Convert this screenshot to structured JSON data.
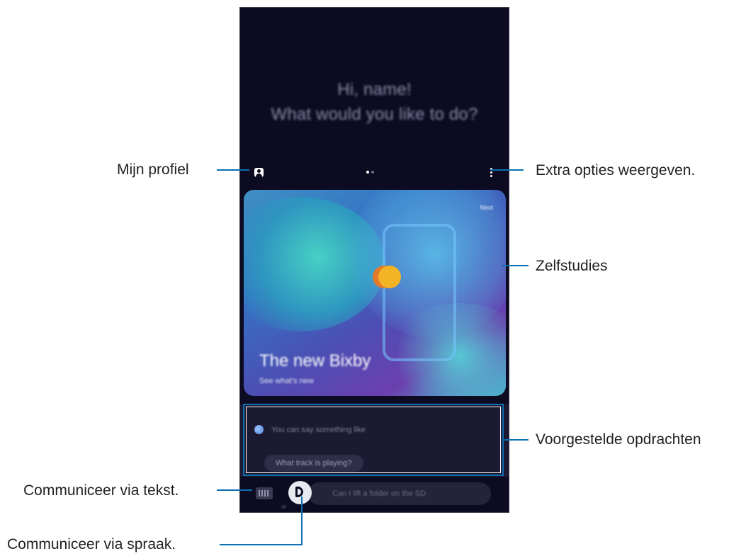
{
  "phone": {
    "greeting_line1": "Hi, name!",
    "greeting_line2": "What would you like to do?",
    "card_badge": "Next",
    "card_title": "The new Bixby",
    "card_subtitle": "See what's new",
    "suggest_hint": "You can say something like",
    "suggest_chip": "What track is playing?",
    "input_text": "Can I lift a folder on the SD",
    "input_small": "or"
  },
  "callouts": {
    "profile": "Mijn profiel",
    "more_options": "Extra opties weergeven.",
    "tutorials": "Zelfstudies",
    "suggestions": "Voorgestelde opdrachten",
    "text_input": "Communiceer via tekst.",
    "voice_input": "Communiceer via spraak."
  },
  "colors": {
    "callout_line": "#0b6fb2",
    "phone_background": "#0c0b22"
  }
}
